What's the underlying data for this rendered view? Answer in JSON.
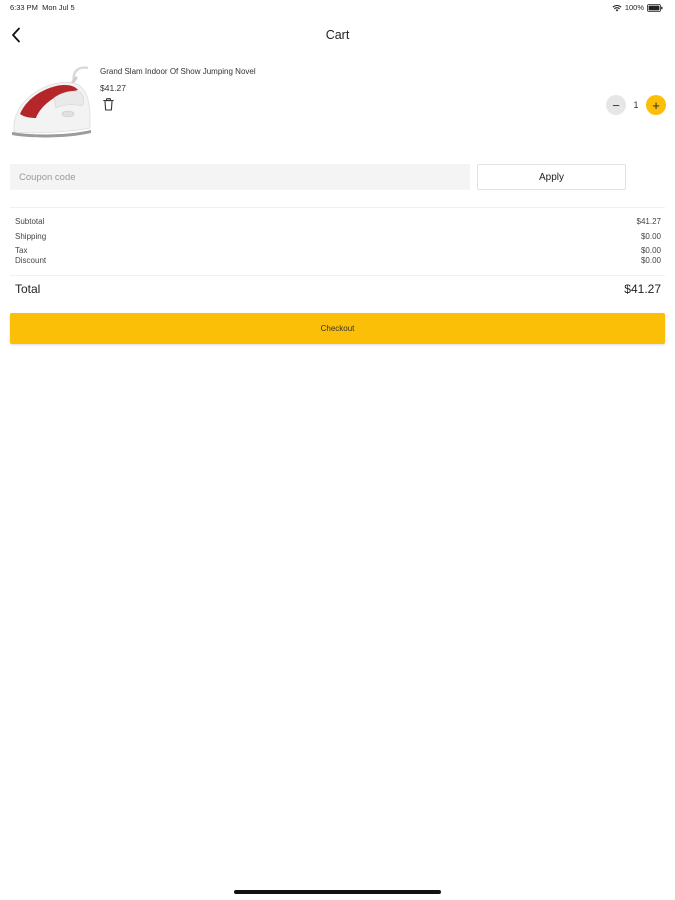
{
  "status_bar": {
    "time": "6:33 PM",
    "date": "Mon Jul 5",
    "battery": "100%"
  },
  "header": {
    "title": "Cart",
    "back_icon": "chevron-left-icon"
  },
  "cart_item": {
    "name": "Grand Slam Indoor Of Show Jumping Novel",
    "price": "$41.27",
    "quantity": "1",
    "minus_label": "−",
    "plus_label": "+",
    "delete_icon": "trash-icon"
  },
  "coupon": {
    "placeholder": "Coupon code",
    "value": "",
    "apply_label": "Apply"
  },
  "summary": {
    "subtotal_label": "Subtotal",
    "subtotal_value": "$41.27",
    "shipping_label": "Shipping",
    "shipping_value": "$0.00",
    "tax_label": "Tax",
    "tax_value": "$0.00",
    "discount_label": "Discount",
    "discount_value": "$0.00",
    "total_label": "Total",
    "total_value": "$41.27"
  },
  "checkout": {
    "label": "Checkout"
  },
  "colors": {
    "accent": "#fbbf08",
    "input_bg": "#f4f4f4",
    "product_red": "#b5262b"
  }
}
